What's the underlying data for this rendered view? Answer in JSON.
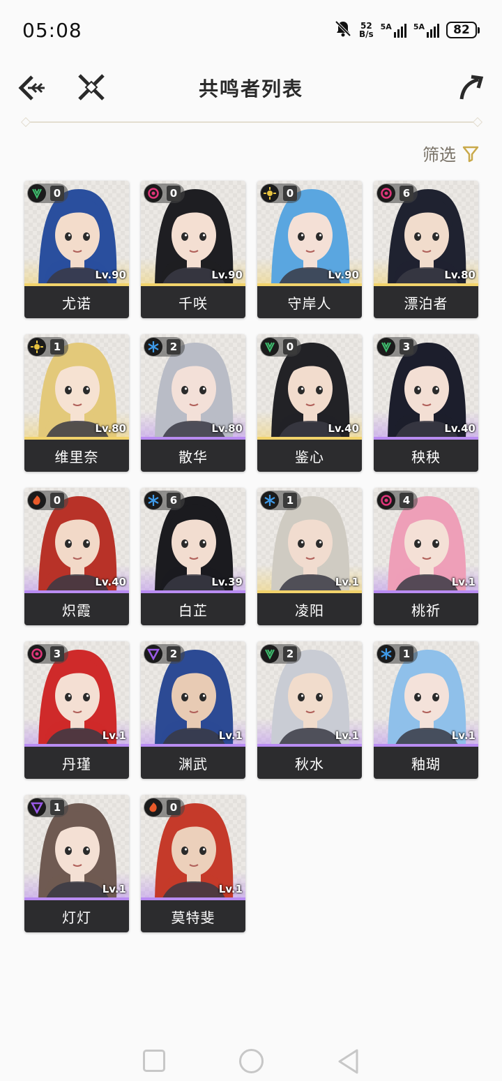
{
  "status_bar": {
    "time": "05:08",
    "net_speed_value": "52",
    "net_speed_unit": "B/s",
    "signal1_label": "5A",
    "signal2_label": "5A",
    "battery": "82"
  },
  "header": {
    "title": "共鸣者列表",
    "back_icon": "double-chevron-left-icon",
    "close_icon": "cross-icon",
    "share_icon": "curved-arrow-icon"
  },
  "filter": {
    "label": "筛选",
    "icon": "funnel-icon",
    "accent": "#c9a94a"
  },
  "elements": {
    "aero": "#3fbf6f",
    "fusion": "#e85a2a",
    "havoc": "#e0357a",
    "spectro": "#e8c440",
    "glacio": "#3e9ae8",
    "electro": "#9a5ae8"
  },
  "characters": [
    {
      "name": "尤诺",
      "level": "Lv.90",
      "sequence": "0",
      "element": "aero",
      "rarity": "gold",
      "hair": "#2a4f9e",
      "skin": "#f3dccb"
    },
    {
      "name": "千咲",
      "level": "Lv.90",
      "sequence": "0",
      "element": "havoc",
      "rarity": "gold",
      "hair": "#1e1e22",
      "skin": "#f4dfd2"
    },
    {
      "name": "守岸人",
      "level": "Lv.90",
      "sequence": "0",
      "element": "spectro",
      "rarity": "gold",
      "hair": "#5aa6e0",
      "skin": "#f4e0d6"
    },
    {
      "name": "漂泊者",
      "level": "Lv.80",
      "sequence": "6",
      "element": "havoc",
      "rarity": "gold",
      "hair": "#1f2230",
      "skin": "#f1dccc"
    },
    {
      "name": "维里奈",
      "level": "Lv.80",
      "sequence": "1",
      "element": "spectro",
      "rarity": "gold",
      "hair": "#e3c97a",
      "skin": "#f6e2d2"
    },
    {
      "name": "散华",
      "level": "Lv.80",
      "sequence": "2",
      "element": "glacio",
      "rarity": "purple",
      "hair": "#b9bcc6",
      "skin": "#f3e0d8"
    },
    {
      "name": "鉴心",
      "level": "Lv.40",
      "sequence": "0",
      "element": "aero",
      "rarity": "gold",
      "hair": "#222226",
      "skin": "#f2dccd"
    },
    {
      "name": "秧秧",
      "level": "Lv.40",
      "sequence": "3",
      "element": "aero",
      "rarity": "purple",
      "hair": "#1c1e2c",
      "skin": "#f3dfd4"
    },
    {
      "name": "炽霞",
      "level": "Lv.40",
      "sequence": "0",
      "element": "fusion",
      "rarity": "purple",
      "hair": "#b83228",
      "skin": "#f2d9c8"
    },
    {
      "name": "白芷",
      "level": "Lv.39",
      "sequence": "6",
      "element": "glacio",
      "rarity": "purple",
      "hair": "#1b1b1f",
      "skin": "#f2ddd0"
    },
    {
      "name": "凌阳",
      "level": "Lv.1",
      "sequence": "1",
      "element": "glacio",
      "rarity": "gold",
      "hair": "#cfcbc2",
      "skin": "#f1dccf"
    },
    {
      "name": "桃祈",
      "level": "Lv.1",
      "sequence": "4",
      "element": "havoc",
      "rarity": "purple",
      "hair": "#ee9fb8",
      "skin": "#f4e0d6"
    },
    {
      "name": "丹瑾",
      "level": "Lv.1",
      "sequence": "3",
      "element": "havoc",
      "rarity": "purple",
      "hair": "#cf2a2a",
      "skin": "#f4dfd3"
    },
    {
      "name": "渊武",
      "level": "Lv.1",
      "sequence": "2",
      "element": "electro",
      "rarity": "purple",
      "hair": "#2c4a94",
      "skin": "#e8cbb4"
    },
    {
      "name": "秋水",
      "level": "Lv.1",
      "sequence": "2",
      "element": "aero",
      "rarity": "purple",
      "hair": "#c9ccd4",
      "skin": "#f1dccc"
    },
    {
      "name": "釉瑚",
      "level": "Lv.1",
      "sequence": "1",
      "element": "glacio",
      "rarity": "purple",
      "hair": "#8fc0ea",
      "skin": "#f4e2da"
    },
    {
      "name": "灯灯",
      "level": "Lv.1",
      "sequence": "1",
      "element": "electro",
      "rarity": "purple",
      "hair": "#6f5a52",
      "skin": "#f4e0d4"
    },
    {
      "name": "莫特斐",
      "level": "Lv.1",
      "sequence": "0",
      "element": "fusion",
      "rarity": "purple",
      "hair": "#c53a2a",
      "skin": "#ecd0bb"
    }
  ],
  "nav_bar": {
    "recent_icon": "square-icon",
    "home_icon": "circle-icon",
    "back_icon": "triangle-back-icon"
  }
}
